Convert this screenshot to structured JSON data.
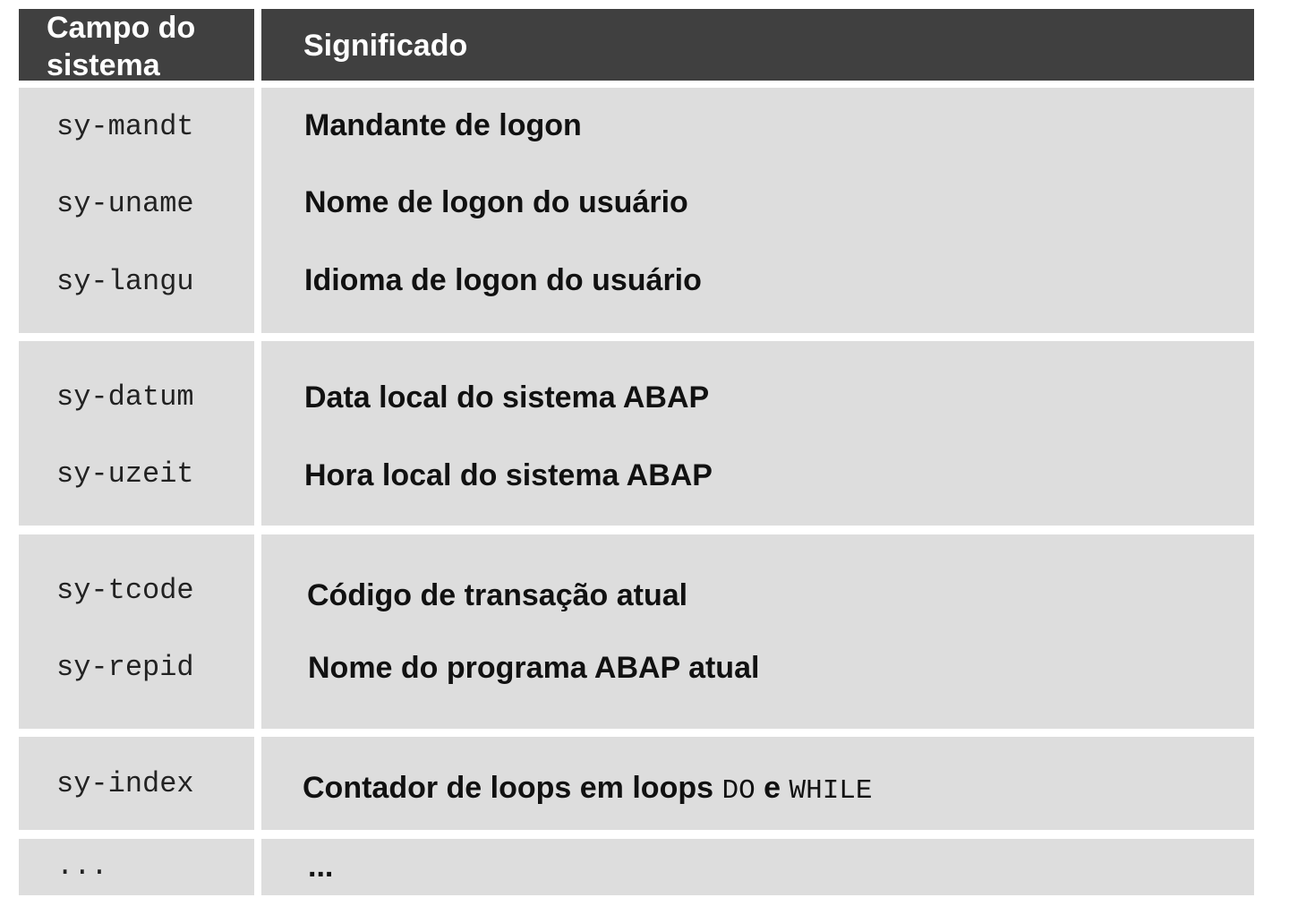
{
  "header": {
    "field_col_line1": "Campo do",
    "field_col_line2": "sistema",
    "meaning_col": "Significado"
  },
  "groups": [
    {
      "rows": [
        {
          "field": "sy-mandt",
          "meaning": "Mandante de logon"
        },
        {
          "field": "sy-uname",
          "meaning": "Nome de logon do usuário"
        },
        {
          "field": "sy-langu",
          "meaning": "Idioma de logon do usuário"
        }
      ]
    },
    {
      "rows": [
        {
          "field": "sy-datum",
          "meaning": "Data local do sistema ABAP"
        },
        {
          "field": "sy-uzeit",
          "meaning": "Hora local do sistema ABAP"
        }
      ]
    },
    {
      "rows": [
        {
          "field": "sy-tcode",
          "meaning": "Código de transação atual"
        },
        {
          "field": "sy-repid",
          "meaning": "Nome do programa ABAP atual"
        }
      ]
    },
    {
      "rows": [
        {
          "field": "sy-index",
          "meaning_prefix": "Contador de loops em loops ",
          "meaning_kw1": "DO",
          "meaning_mid": " e ",
          "meaning_kw2": "WHILE"
        }
      ]
    },
    {
      "rows": [
        {
          "field": "...",
          "meaning": "..."
        }
      ]
    }
  ]
}
